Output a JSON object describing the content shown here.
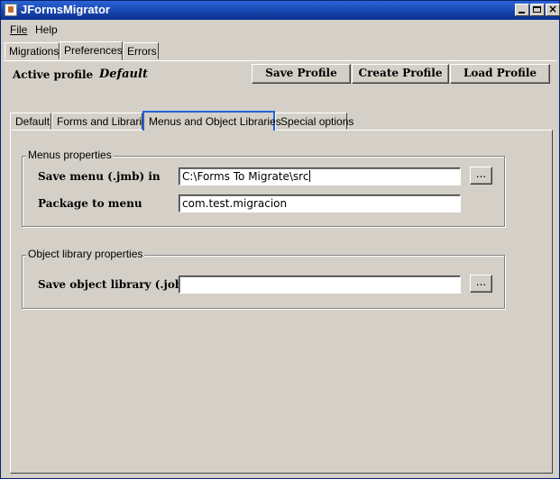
{
  "window": {
    "title": "JFormsMigrator"
  },
  "menubar": {
    "items": [
      "File",
      "Help"
    ]
  },
  "main_tabs": [
    "Migrations",
    "Preferences",
    "Errors"
  ],
  "active_main_tab": "Preferences",
  "profile": {
    "label": "Active profile",
    "name": "Default",
    "buttons": {
      "save": "Save Profile",
      "create": "Create Profile",
      "load": "Load Profile"
    }
  },
  "sub_tabs": [
    "Default",
    "Forms and Libraries",
    "Menus and Object Libraries",
    "Special options"
  ],
  "active_sub_tab": "Menus and Object Libraries",
  "menus_group": {
    "legend": "Menus properties",
    "save_menu_label": "Save menu (.jmb) in",
    "save_menu_value": "C:\\Forms To Migrate\\src",
    "package_label": "Package to menu",
    "package_value": "com.test.migracion",
    "browse_label": "..."
  },
  "objlib_group": {
    "legend": "Object library properties",
    "save_objlib_label": "Save object library (.job) in",
    "save_objlib_value": "",
    "browse_label": "..."
  },
  "icons": {
    "app": "coffee-cup-icon",
    "minimize": "minimize-icon",
    "maximize": "maximize-icon",
    "close": "close-icon"
  }
}
